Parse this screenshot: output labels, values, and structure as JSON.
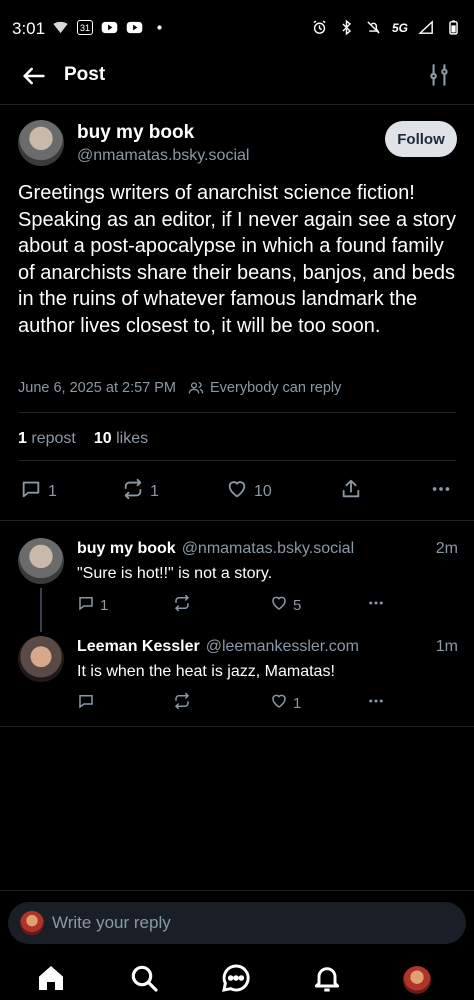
{
  "status_bar": {
    "time": "3:01",
    "calendar_day": "31",
    "network": "5G"
  },
  "header": {
    "title": "Post"
  },
  "post": {
    "display_name": "buy my book",
    "handle": "@nmamatas.bsky.social",
    "follow_label": "Follow",
    "body": "Greetings writers of anarchist science fiction! Speaking as an editor, if I never again see a story about a post-apocalypse in which a found family of anarchists share their beans, banjos, and beds in the ruins of whatever famous landmark the author lives closest to, it will be too soon.",
    "timestamp": "June 6, 2025 at 2:57 PM",
    "reply_setting": "Everybody can reply",
    "reposts_count": "1",
    "reposts_label": "repost",
    "likes_count": "10",
    "likes_label": "likes",
    "actions": {
      "replies": "1",
      "reposts": "1",
      "likes": "10"
    }
  },
  "replies": [
    {
      "display_name": "buy my book",
      "handle": "@nmamatas.bsky.social",
      "time": "2m",
      "text": "\"Sure is hot!!\" is not a story.",
      "reply_count": "1",
      "like_count": "5"
    },
    {
      "display_name": "Leeman Kessler",
      "handle": "@leemankessler.com",
      "time": "1m",
      "text": "It is when the heat is jazz, Mamatas!",
      "reply_count": "",
      "like_count": "1"
    }
  ],
  "compose": {
    "placeholder": "Write your reply"
  },
  "icons": [
    "back-arrow-icon",
    "filter-sliders-icon",
    "reply-icon",
    "repost-icon",
    "heart-icon",
    "share-icon",
    "more-icon",
    "home-icon",
    "search-icon",
    "chat-icon",
    "bell-icon"
  ],
  "colors": {
    "background": "#000000",
    "text_primary": "#f1f3f5",
    "text_muted": "#8b98a5",
    "follow_button": "#dfe3e8"
  }
}
